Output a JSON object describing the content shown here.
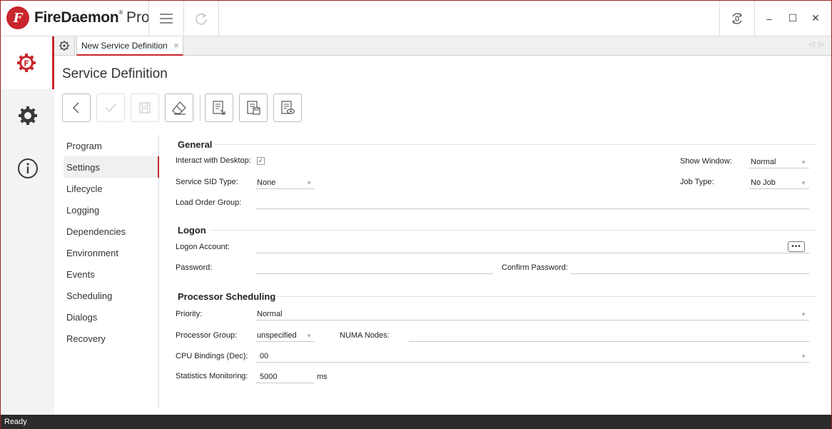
{
  "app": {
    "brand": "FireDaemon",
    "reg": "®",
    "edition": "Pro",
    "logo_letter": "F"
  },
  "colors": {
    "accent": "#c8262c",
    "statusbar": "#2b2b2b"
  },
  "titlebar_icons": [
    "menu-icon",
    "redo-icon",
    "update-icon",
    "minimize-icon",
    "maximize-icon",
    "close-icon"
  ],
  "window_controls": {
    "minimize": "–",
    "maximize": "☐",
    "close": "✕"
  },
  "leftnav": [
    "services-icon",
    "settings-gear-icon",
    "info-icon"
  ],
  "tabs": [
    {
      "label": "New Service Definition",
      "close": "×"
    }
  ],
  "page": {
    "title": "Service Definition"
  },
  "toolbar": [
    "back-icon",
    "check-icon",
    "save-icon",
    "eraser-icon",
    "import-icon",
    "export-icon",
    "preview-icon"
  ],
  "sections": [
    {
      "label": "Program"
    },
    {
      "label": "Settings"
    },
    {
      "label": "Lifecycle"
    },
    {
      "label": "Logging"
    },
    {
      "label": "Dependencies"
    },
    {
      "label": "Environment"
    },
    {
      "label": "Events"
    },
    {
      "label": "Scheduling"
    },
    {
      "label": "Dialogs"
    },
    {
      "label": "Recovery"
    }
  ],
  "active_section": "Settings",
  "general": {
    "title": "General",
    "interact_label": "Interact with Desktop:",
    "interact_checked": "✓",
    "show_window_label": "Show Window:",
    "show_window_value": "Normal",
    "sid_type_label": "Service SID Type:",
    "sid_type_value": "None",
    "job_type_label": "Job Type:",
    "job_type_value": "No Job",
    "load_order_label": "Load Order Group:",
    "load_order_value": ""
  },
  "logon": {
    "title": "Logon",
    "account_label": "Logon Account:",
    "account_value": "",
    "browse_label": "•••",
    "password_label": "Password:",
    "password_value": "",
    "confirm_label": "Confirm Password:",
    "confirm_value": ""
  },
  "processor": {
    "title": "Processor Scheduling",
    "priority_label": "Priority:",
    "priority_value": "Normal",
    "group_label": "Processor Group:",
    "group_value": "unspecified",
    "numa_label": "NUMA Nodes:",
    "numa_value": "",
    "cpu_label": "CPU Bindings (Dec):",
    "cpu_value": "00",
    "stats_label": "Statistics Monitoring:",
    "stats_value": "5000",
    "stats_unit": "ms"
  },
  "status": {
    "text": "Ready"
  }
}
